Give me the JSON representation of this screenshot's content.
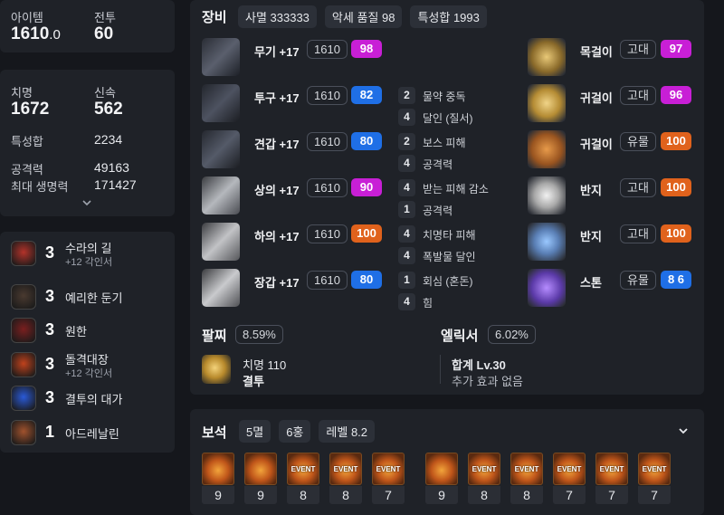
{
  "stats_top": {
    "item_label": "아이템",
    "item_value": "1610",
    "item_value_dec": ".0",
    "battle_label": "전투",
    "battle_value": "60"
  },
  "stats_main": {
    "crit_label": "치명",
    "crit_value": "1672",
    "swift_label": "신속",
    "swift_value": "562",
    "sum_label": "특성합",
    "sum_value": "2234",
    "atk_label": "공격력",
    "atk_value": "49163",
    "hp_label": "최대 생명력",
    "hp_value": "171427",
    "expand_icon": "chevron-down-icon"
  },
  "engravings": [
    {
      "level": "3",
      "name": "수라의 길",
      "sub": "+12 각인서",
      "color": "#b3332a"
    },
    {
      "level": "3",
      "name": "예리한 둔기",
      "sub": "",
      "color": "#4a3a30"
    },
    {
      "level": "3",
      "name": "원한",
      "sub": "",
      "color": "#7a1f1f"
    },
    {
      "level": "3",
      "name": "돌격대장",
      "sub": "+12 각인서",
      "color": "#c0421c"
    },
    {
      "level": "3",
      "name": "결투의 대가",
      "sub": "",
      "color": "#2a5ad8"
    },
    {
      "level": "1",
      "name": "아드레날린",
      "sub": "",
      "color": "#a0522d"
    }
  ],
  "equipment": {
    "title": "장비",
    "tags": [
      "사멸 333333",
      "악세 품질 98",
      "특성합 1993"
    ],
    "gear": [
      {
        "name": "무기 +17",
        "ilvl": "1610",
        "quality": "98",
        "grade": "ancient"
      },
      {
        "name": "투구 +17",
        "ilvl": "1610",
        "quality": "82",
        "grade": "legend"
      },
      {
        "name": "견갑 +17",
        "ilvl": "1610",
        "quality": "80",
        "grade": "legend"
      },
      {
        "name": "상의 +17",
        "ilvl": "1610",
        "quality": "90",
        "grade": "ancient"
      },
      {
        "name": "하의 +17",
        "ilvl": "1610",
        "quality": "100",
        "grade": "relic"
      },
      {
        "name": "장갑 +17",
        "ilvl": "1610",
        "quality": "80",
        "grade": "legend"
      }
    ],
    "effects": [
      {
        "num": "2",
        "text": "물약 중독"
      },
      {
        "num": "4",
        "text": "달인 (질서)"
      },
      {
        "num": "2",
        "text": "보스 피해"
      },
      {
        "num": "4",
        "text": "공격력"
      },
      {
        "num": "4",
        "text": "받는 피해 감소"
      },
      {
        "num": "1",
        "text": "공격력"
      },
      {
        "num": "4",
        "text": "치명타 피해"
      },
      {
        "num": "4",
        "text": "폭발물 달인"
      },
      {
        "num": "1",
        "text": "회심 (혼돈)"
      },
      {
        "num": "4",
        "text": "힘"
      }
    ],
    "accessories": [
      {
        "name": "목걸이",
        "tier": "고대",
        "quality": "97",
        "grade": "ancient"
      },
      {
        "name": "귀걸이",
        "tier": "고대",
        "quality": "96",
        "grade": "ancient"
      },
      {
        "name": "귀걸이",
        "tier": "유물",
        "quality": "100",
        "grade": "relic"
      },
      {
        "name": "반지",
        "tier": "고대",
        "quality": "100",
        "grade": "relic"
      },
      {
        "name": "반지",
        "tier": "고대",
        "quality": "100",
        "grade": "relic"
      },
      {
        "name": "스톤",
        "tier": "유물",
        "quality": "8 6",
        "grade": "legend"
      }
    ],
    "bracelet": {
      "label": "팔찌",
      "pct": "8.59%",
      "stat": "치명 110",
      "sub": "결투"
    },
    "elixir": {
      "label": "엘릭서",
      "pct": "6.02%",
      "line1": "합계 Lv.30",
      "line2": "추가 효과 없음"
    }
  },
  "gems": {
    "title": "보석",
    "tags": [
      "5멸",
      "6홍",
      "레벨 8.2"
    ],
    "toggle_icon": "chevron-down-icon",
    "left": [
      {
        "level": "9",
        "event": ""
      },
      {
        "level": "9",
        "event": ""
      },
      {
        "level": "8",
        "event": "EVENT"
      },
      {
        "level": "8",
        "event": "EVENT"
      },
      {
        "level": "7",
        "event": "EVENT"
      }
    ],
    "right": [
      {
        "level": "9",
        "event": ""
      },
      {
        "level": "8",
        "event": "EVENT"
      },
      {
        "level": "8",
        "event": "EVENT"
      },
      {
        "level": "7",
        "event": "EVENT"
      },
      {
        "level": "7",
        "event": "EVENT"
      },
      {
        "level": "7",
        "event": "EVENT"
      }
    ]
  }
}
